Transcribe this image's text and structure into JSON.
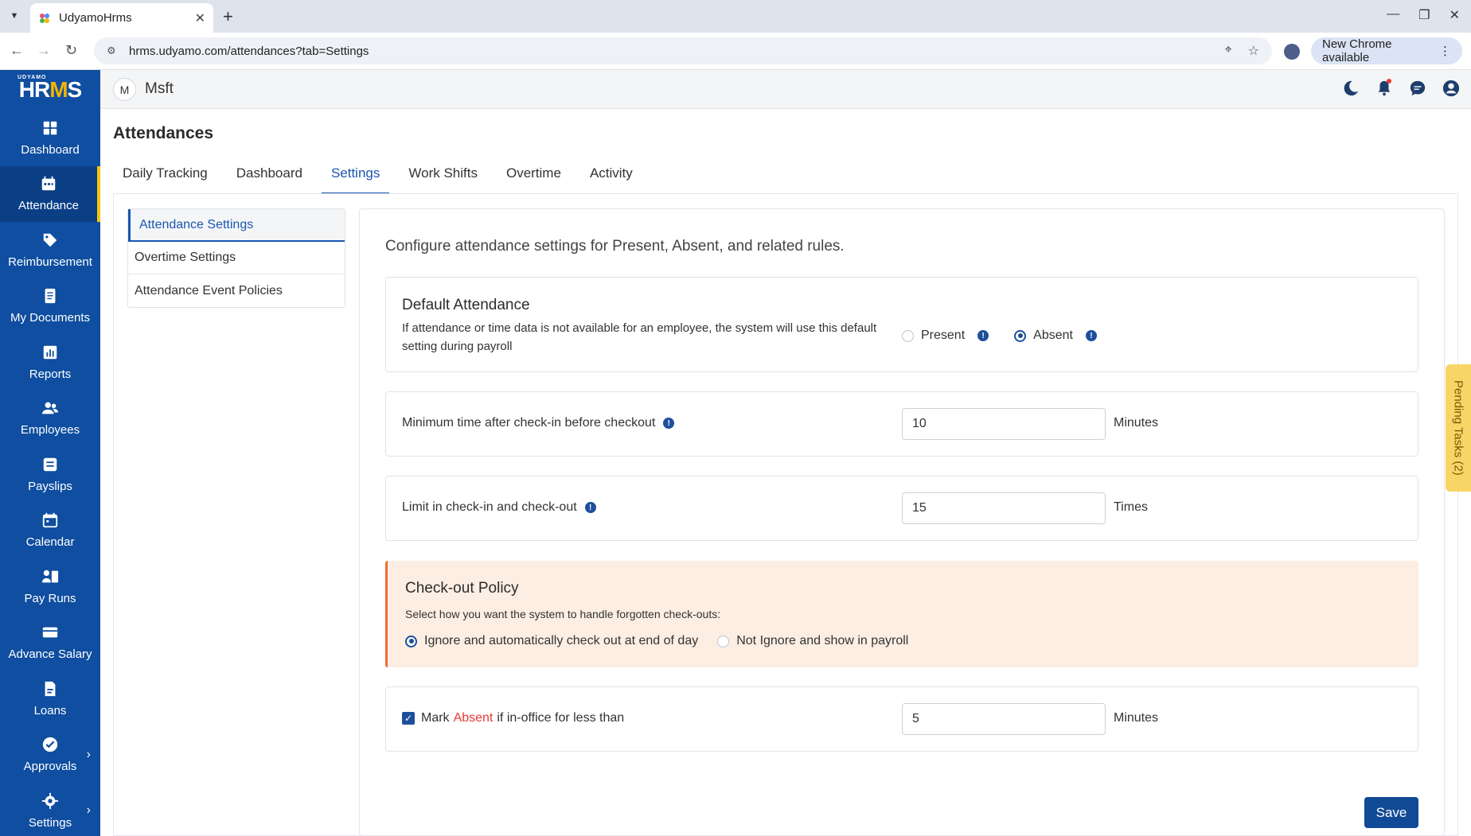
{
  "browser": {
    "tab_title": "UdyamoHrms",
    "url": "hrms.udyamo.com/attendances?tab=Settings",
    "update_label": "New Chrome available"
  },
  "sidebar": {
    "logo_small": "UDYAMO",
    "logo_text_1": "HR",
    "logo_text_m": "M",
    "logo_text_2": "S",
    "items": [
      {
        "label": "Dashboard",
        "icon": "dashboard-icon"
      },
      {
        "label": "Attendance",
        "icon": "calendar-icon",
        "active": true
      },
      {
        "label": "Reimbursement",
        "icon": "tags-icon"
      },
      {
        "label": "My Documents",
        "icon": "documents-icon"
      },
      {
        "label": "Reports",
        "icon": "chart-icon"
      },
      {
        "label": "Employees",
        "icon": "users-icon"
      },
      {
        "label": "Payslips",
        "icon": "payslip-icon"
      },
      {
        "label": "Calendar",
        "icon": "calendar-icon"
      },
      {
        "label": "Pay Runs",
        "icon": "pay-runs-icon"
      },
      {
        "label": "Advance Salary",
        "icon": "card-icon"
      },
      {
        "label": "Loans",
        "icon": "loan-icon"
      },
      {
        "label": "Approvals",
        "icon": "check-circle-icon"
      },
      {
        "label": "Settings",
        "icon": "gear-icon"
      }
    ]
  },
  "header": {
    "org_initial": "M",
    "org_name": "Msft"
  },
  "page": {
    "title": "Attendances",
    "tabs": [
      "Daily Tracking",
      "Dashboard",
      "Settings",
      "Work Shifts",
      "Overtime",
      "Activity"
    ],
    "active_tab": "Settings"
  },
  "subnav": {
    "items": [
      "Attendance Settings",
      "Overtime Settings",
      "Attendance Event Policies"
    ]
  },
  "settings": {
    "description": "Configure attendance settings for Present, Absent, and related rules.",
    "default_attendance": {
      "title": "Default Attendance",
      "text": "If attendance or time data is not available for an employee, the system will use this default setting during payroll",
      "option_present": "Present",
      "option_absent": "Absent",
      "selected": "Absent"
    },
    "min_time": {
      "label": "Minimum time after check-in before checkout",
      "value": "10",
      "unit": "Minutes"
    },
    "limit": {
      "label": "Limit in check-in and check-out",
      "value": "15",
      "unit": "Times"
    },
    "checkout_policy": {
      "title": "Check-out Policy",
      "subtitle": "Select how you want the system to handle forgotten check-outs:",
      "option_ignore": "Ignore and automatically check out at end of day",
      "option_not_ignore": "Not Ignore and show in payroll",
      "selected": "ignore"
    },
    "mark_absent": {
      "prefix": "Mark",
      "highlight": "Absent",
      "suffix": "if in-office for less than",
      "value": "5",
      "unit": "Minutes",
      "checked": true
    },
    "save_label": "Save"
  },
  "pending_tasks": "Pending Tasks (2)",
  "colors": {
    "sidebar": "#0f4ea0",
    "accent": "#1a56b0",
    "active_indicator": "#f7c50b",
    "policy_bg": "#fdeee3",
    "absent_red": "#e53935"
  }
}
